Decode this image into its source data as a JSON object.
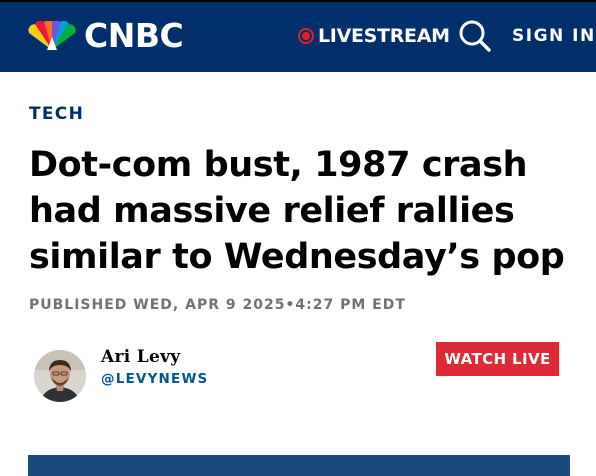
{
  "header": {
    "logo_text": "CNBC",
    "livestream_label": "LIVESTREAM",
    "signin_label": "SIGN IN",
    "search_icon": "search-icon",
    "live_icon": "live-dot-icon"
  },
  "article": {
    "section": "TECH",
    "headline": "Dot-com bust, 1987 crash had massive relief rallies similar to Wednesday’s pop",
    "published": "PUBLISHED WED, APR 9 2025•4:27 PM EDT"
  },
  "author": {
    "name": "Ari Levy",
    "handle": "@LEVYNEWS"
  },
  "cta": {
    "watch_live_label": "WATCH LIVE"
  },
  "colors": {
    "brand_navy": "#002f6c",
    "live_red": "#e21f26",
    "watch_live_bg": "#dc2a37",
    "handle_blue": "#005594"
  }
}
